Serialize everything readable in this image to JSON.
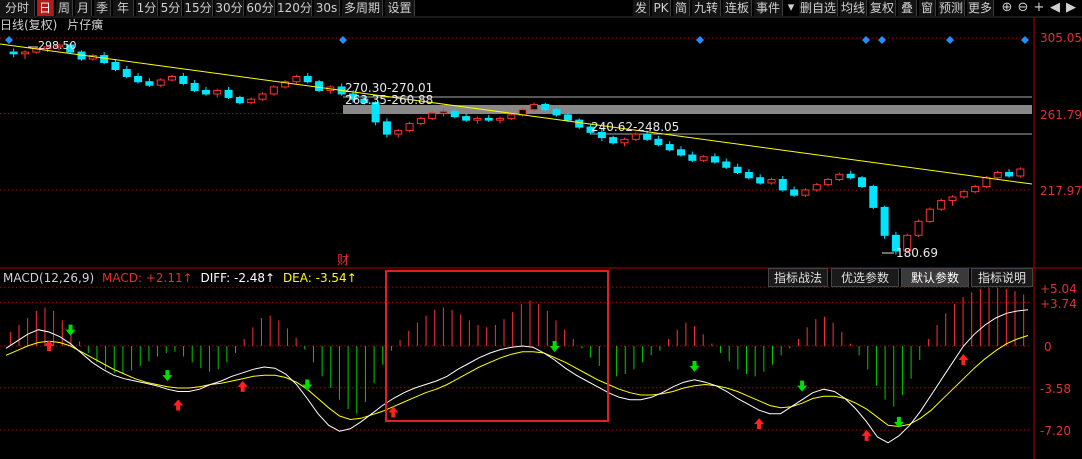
{
  "toolbar": {
    "left_buttons": [
      "分时",
      "日",
      "周",
      "月",
      "季",
      "年",
      "1分",
      "5分",
      "15分",
      "30分",
      "60分",
      "120分",
      "30s",
      "多周期",
      "设置"
    ],
    "active": "日",
    "right_buttons": [
      "发",
      "PK",
      "简",
      "九转",
      "连板",
      "事件",
      "删自选",
      "均线",
      "复权",
      "叠",
      "窗",
      "预测",
      "更多"
    ]
  },
  "subheader": {
    "title": "日线(复权)",
    "stock": "片仔癀"
  },
  "price_axis": {
    "labels": [
      "305.05",
      "261.79",
      "217.97"
    ]
  },
  "annotations": {
    "high": "298.50",
    "low": "180.69",
    "gap1": "270.30-270.01",
    "gap2": "263.35-260.88",
    "gap3": "240.62-248.05",
    "event_marker": "财"
  },
  "macd": {
    "name": "MACD(12,26,9)",
    "macd_label": "MACD:",
    "macd_value": "+2.11↑",
    "diff_label": "DIFF:",
    "diff_value": "-2.48↑",
    "dea_label": "DEA:",
    "dea_value": "-3.54↑",
    "axis_labels": [
      "+5.04",
      "+3.74",
      "0",
      "-3.58",
      "-7.20"
    ]
  },
  "indicator_tabs": [
    "指标战法",
    "优选参数",
    "默认参数",
    "指标说明"
  ],
  "indicator_active": "默认参数",
  "colors": {
    "up": "#ff3232",
    "down": "#00e5ff",
    "trend": "#ffff00",
    "macd_pos": "#ff3232",
    "macd_neg": "#00cc00",
    "diff": "#ffffff",
    "dea": "#ffff00",
    "diamond": "#1e90ff",
    "highlight_box": "#e02020",
    "gap_band": "#888888",
    "axis": "#b00000"
  },
  "chart_data": {
    "type": "candlestick",
    "price_range": [
      175,
      308
    ],
    "price_gridlines": [
      305.05,
      261.79,
      217.97
    ],
    "candles": [
      [
        297,
        299,
        294,
        296
      ],
      [
        296,
        298,
        293,
        297
      ],
      [
        297,
        300,
        296,
        299
      ],
      [
        299,
        301,
        297,
        300
      ],
      [
        300,
        302,
        298,
        301
      ],
      [
        301,
        302,
        296,
        297
      ],
      [
        297,
        298,
        292,
        293
      ],
      [
        293,
        296,
        292,
        295
      ],
      [
        295,
        297,
        290,
        291
      ],
      [
        291,
        293,
        286,
        287
      ],
      [
        287,
        289,
        282,
        283
      ],
      [
        283,
        285,
        279,
        280
      ],
      [
        280,
        282,
        277,
        278
      ],
      [
        278,
        282,
        277,
        281
      ],
      [
        281,
        284,
        280,
        283
      ],
      [
        283,
        285,
        278,
        279
      ],
      [
        279,
        281,
        274,
        275
      ],
      [
        275,
        277,
        272,
        273
      ],
      [
        273,
        276,
        271,
        275
      ],
      [
        275,
        277,
        270,
        271
      ],
      [
        271,
        272,
        267,
        268
      ],
      [
        268,
        271,
        267,
        270
      ],
      [
        270,
        274,
        269,
        273
      ],
      [
        273,
        278,
        272,
        277
      ],
      [
        277,
        281,
        276,
        280
      ],
      [
        280,
        284,
        279,
        283
      ],
      [
        283,
        285,
        279,
        280
      ],
      [
        280,
        281,
        274,
        275
      ],
      [
        275,
        278,
        273,
        277
      ],
      [
        277,
        279,
        272,
        273
      ],
      [
        273,
        275,
        268,
        270
      ],
      [
        270,
        272,
        267,
        268
      ],
      [
        268,
        269,
        255,
        257
      ],
      [
        257,
        259,
        248,
        250
      ],
      [
        250,
        253,
        248,
        252
      ],
      [
        252,
        257,
        251,
        256
      ],
      [
        256,
        260,
        255,
        259
      ],
      [
        259,
        263,
        258,
        262
      ],
      [
        262,
        265,
        260,
        263
      ],
      [
        263,
        264,
        259,
        260
      ],
      [
        260,
        262,
        257,
        258
      ],
      [
        258,
        260,
        256,
        259
      ],
      [
        259,
        261,
        257,
        258
      ],
      [
        258,
        260,
        256,
        259
      ],
      [
        259,
        262,
        258,
        261
      ],
      [
        261,
        265,
        260,
        264
      ],
      [
        264,
        268,
        263,
        267
      ],
      [
        267,
        268,
        263,
        264
      ],
      [
        264,
        265,
        260,
        261
      ],
      [
        261,
        262,
        257,
        258
      ],
      [
        258,
        259,
        253,
        254
      ],
      [
        254,
        256,
        250,
        251
      ],
      [
        251,
        253,
        246,
        248
      ],
      [
        248,
        249,
        244,
        245
      ],
      [
        245,
        248,
        243,
        247
      ],
      [
        247,
        251,
        246,
        250
      ],
      [
        250,
        252,
        246,
        247
      ],
      [
        247,
        249,
        243,
        244
      ],
      [
        244,
        246,
        240,
        241
      ],
      [
        241,
        243,
        237,
        238
      ],
      [
        238,
        240,
        234,
        235
      ],
      [
        235,
        238,
        234,
        237
      ],
      [
        237,
        239,
        233,
        234
      ],
      [
        234,
        236,
        230,
        231
      ],
      [
        231,
        233,
        227,
        228
      ],
      [
        228,
        230,
        224,
        225
      ],
      [
        225,
        227,
        221,
        222
      ],
      [
        222,
        225,
        221,
        224
      ],
      [
        224,
        226,
        217,
        218
      ],
      [
        218,
        220,
        214,
        215
      ],
      [
        215,
        219,
        214,
        218
      ],
      [
        218,
        222,
        217,
        221
      ],
      [
        221,
        225,
        220,
        224
      ],
      [
        224,
        228,
        223,
        227
      ],
      [
        227,
        229,
        224,
        225
      ],
      [
        225,
        226,
        219,
        220
      ],
      [
        220,
        221,
        207,
        208
      ],
      [
        208,
        209,
        190,
        192
      ],
      [
        192,
        194,
        181,
        183
      ],
      [
        183,
        193,
        182,
        192
      ],
      [
        192,
        201,
        191,
        200
      ],
      [
        200,
        208,
        199,
        207
      ],
      [
        207,
        213,
        206,
        212
      ],
      [
        212,
        215,
        209,
        214
      ],
      [
        214,
        218,
        213,
        217
      ],
      [
        217,
        221,
        216,
        220
      ],
      [
        220,
        226,
        219,
        225
      ],
      [
        225,
        229,
        224,
        228
      ],
      [
        228,
        230,
        225,
        226
      ],
      [
        226,
        231,
        225,
        230
      ]
    ],
    "macd_range": [
      -8.5,
      5.6
    ],
    "macd_gridlines": [
      5.04,
      3.74,
      0,
      -3.58,
      -7.2
    ],
    "macd_hist": [
      1.2,
      1.8,
      2.4,
      3.0,
      3.3,
      3.0,
      2.2,
      1.2,
      0.4,
      -0.6,
      -1.4,
      -2.0,
      -2.3,
      -2.4,
      -2.1,
      -1.7,
      -1.3,
      -0.9,
      -0.6,
      -0.5,
      -0.9,
      -1.4,
      -1.9,
      -2.2,
      -2.0,
      -1.4,
      -0.6,
      0.6,
      1.6,
      2.4,
      2.6,
      2.2,
      1.5,
      0.7,
      -0.3,
      -1.4,
      -2.6,
      -3.6,
      -4.6,
      -5.4,
      -5.8,
      -4.8,
      -3.2,
      -1.6,
      -0.4,
      0.5,
      1.3,
      2.0,
      2.6,
      3.1,
      3.3,
      3.1,
      2.7,
      2.2,
      1.8,
      1.6,
      1.8,
      2.3,
      2.9,
      3.6,
      3.9,
      3.6,
      3.0,
      2.2,
      1.4,
      0.6,
      -0.2,
      -1.0,
      -1.7,
      -2.3,
      -2.6,
      -2.4,
      -2.0,
      -1.4,
      -0.8,
      -0.4,
      0.6,
      1.4,
      2.0,
      1.7,
      1.0,
      0.2,
      -0.6,
      -1.3,
      -2.0,
      -2.4,
      -2.6,
      -2.2,
      -1.6,
      -0.8,
      -0.2,
      0.6,
      1.6,
      2.3,
      2.5,
      2.0,
      1.2,
      0.2,
      -0.8,
      -2.0,
      -3.4,
      -4.6,
      -5.2,
      -4.2,
      -2.8,
      -1.2,
      0.6,
      1.8,
      2.8,
      3.6,
      4.2,
      4.6,
      4.9,
      5.0,
      5.0,
      4.9,
      4.7,
      4.4
    ],
    "diff": [
      -0.2,
      0.4,
      1.0,
      1.4,
      1.2,
      0.8,
      0.2,
      -0.6,
      -1.4,
      -2.0,
      -2.5,
      -2.8,
      -3.0,
      -3.2,
      -3.4,
      -3.7,
      -3.9,
      -3.9,
      -3.7,
      -3.3,
      -3.0,
      -2.6,
      -2.3,
      -2.0,
      -1.8,
      -1.9,
      -2.4,
      -3.3,
      -4.5,
      -5.8,
      -6.8,
      -7.3,
      -7.1,
      -6.5,
      -5.8,
      -5.1,
      -4.5,
      -4.0,
      -3.6,
      -3.3,
      -3.0,
      -2.6,
      -2.0,
      -1.5,
      -1.0,
      -0.6,
      -0.3,
      -0.1,
      0.0,
      -0.1,
      -0.6,
      -1.2,
      -1.9,
      -2.5,
      -3.0,
      -3.5,
      -4.0,
      -4.4,
      -4.6,
      -4.6,
      -4.4,
      -4.0,
      -3.5,
      -3.1,
      -2.9,
      -3.1,
      -3.4,
      -3.9,
      -4.5,
      -5.0,
      -5.5,
      -5.8,
      -5.8,
      -5.2,
      -4.6,
      -4.0,
      -3.7,
      -3.9,
      -4.5,
      -5.4,
      -6.5,
      -7.8,
      -8.3,
      -7.7,
      -6.8,
      -5.6,
      -4.2,
      -2.8,
      -1.4,
      0.0,
      1.0,
      1.8,
      2.4,
      2.8,
      3.0,
      3.1
    ],
    "dea": [
      -0.8,
      -0.4,
      0.0,
      0.3,
      0.4,
      0.3,
      0.0,
      -0.5,
      -1.0,
      -1.5,
      -2.0,
      -2.4,
      -2.8,
      -3.1,
      -3.3,
      -3.5,
      -3.6,
      -3.6,
      -3.5,
      -3.3,
      -3.2,
      -3.0,
      -2.8,
      -2.6,
      -2.5,
      -2.5,
      -2.7,
      -3.1,
      -3.7,
      -4.5,
      -5.3,
      -6.0,
      -6.3,
      -6.2,
      -5.9,
      -5.6,
      -5.2,
      -4.8,
      -4.4,
      -4.0,
      -3.7,
      -3.3,
      -2.8,
      -2.3,
      -1.8,
      -1.4,
      -1.0,
      -0.7,
      -0.5,
      -0.5,
      -0.6,
      -1.0,
      -1.4,
      -1.9,
      -2.4,
      -2.9,
      -3.3,
      -3.7,
      -4.0,
      -4.2,
      -4.2,
      -4.1,
      -3.9,
      -3.6,
      -3.4,
      -3.3,
      -3.4,
      -3.6,
      -3.9,
      -4.3,
      -4.7,
      -5.1,
      -5.3,
      -5.2,
      -4.9,
      -4.5,
      -4.3,
      -4.3,
      -4.5,
      -4.9,
      -5.4,
      -6.1,
      -6.8,
      -6.9,
      -6.7,
      -6.2,
      -5.5,
      -4.6,
      -3.7,
      -2.8,
      -1.9,
      -1.1,
      -0.4,
      0.2,
      0.6,
      0.9
    ],
    "buy_markers": [
      4,
      16,
      22,
      36,
      70,
      80,
      89
    ],
    "sell_markers": [
      6,
      15,
      28,
      51,
      64,
      74,
      83
    ]
  }
}
